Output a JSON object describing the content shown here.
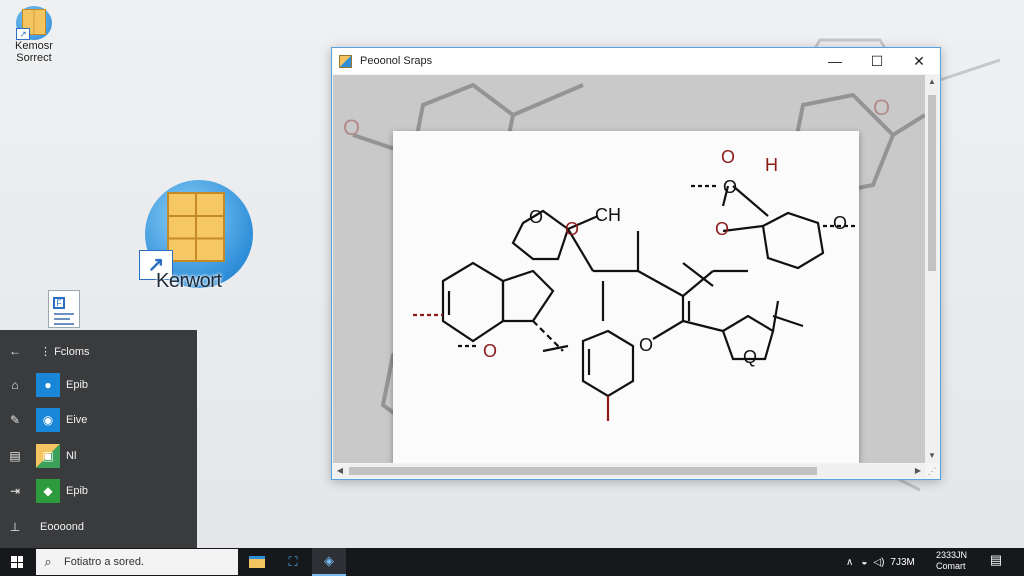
{
  "desktop": {
    "icons": [
      {
        "label_line1": "Kemosr",
        "label_line2": "Sorrect"
      },
      {
        "label": "Kerwort"
      }
    ]
  },
  "window": {
    "title": "Peoonol Sraps",
    "minimize_glyph": "—",
    "maximize_glyph": "☐",
    "close_glyph": "✕",
    "scroll_up": "▲",
    "scroll_down": "▼",
    "scroll_left": "◀",
    "scroll_right": "▶",
    "molecule_labels": {
      "ch": "CH",
      "h": "H",
      "o_top": "O",
      "o_mid": "O",
      "o_right": "O",
      "o_left": "O",
      "o_center": "O",
      "o_ring": "O",
      "o_small": "O",
      "o_low": "O",
      "q": "Q"
    }
  },
  "start_menu": {
    "items": [
      {
        "side_icon": "arrow-left-icon",
        "label": "Fcloms"
      },
      {
        "side_icon": "network-icon",
        "label": "Epib"
      },
      {
        "side_icon": "pen-icon",
        "label": "Eive"
      },
      {
        "side_icon": "grid-icon",
        "label": "Nl"
      },
      {
        "side_icon": "exit-icon",
        "label": "Epib"
      },
      {
        "side_icon": "pin-icon",
        "label": "Eoooond"
      }
    ]
  },
  "taskbar": {
    "search_placeholder": "Fotiatro a sored.",
    "clock_line1": "2333JN",
    "clock_line2": "Comart",
    "tray_time": "7J3M",
    "colors": {
      "accent": "#76b9ed",
      "taskbar": "#16181b"
    }
  }
}
